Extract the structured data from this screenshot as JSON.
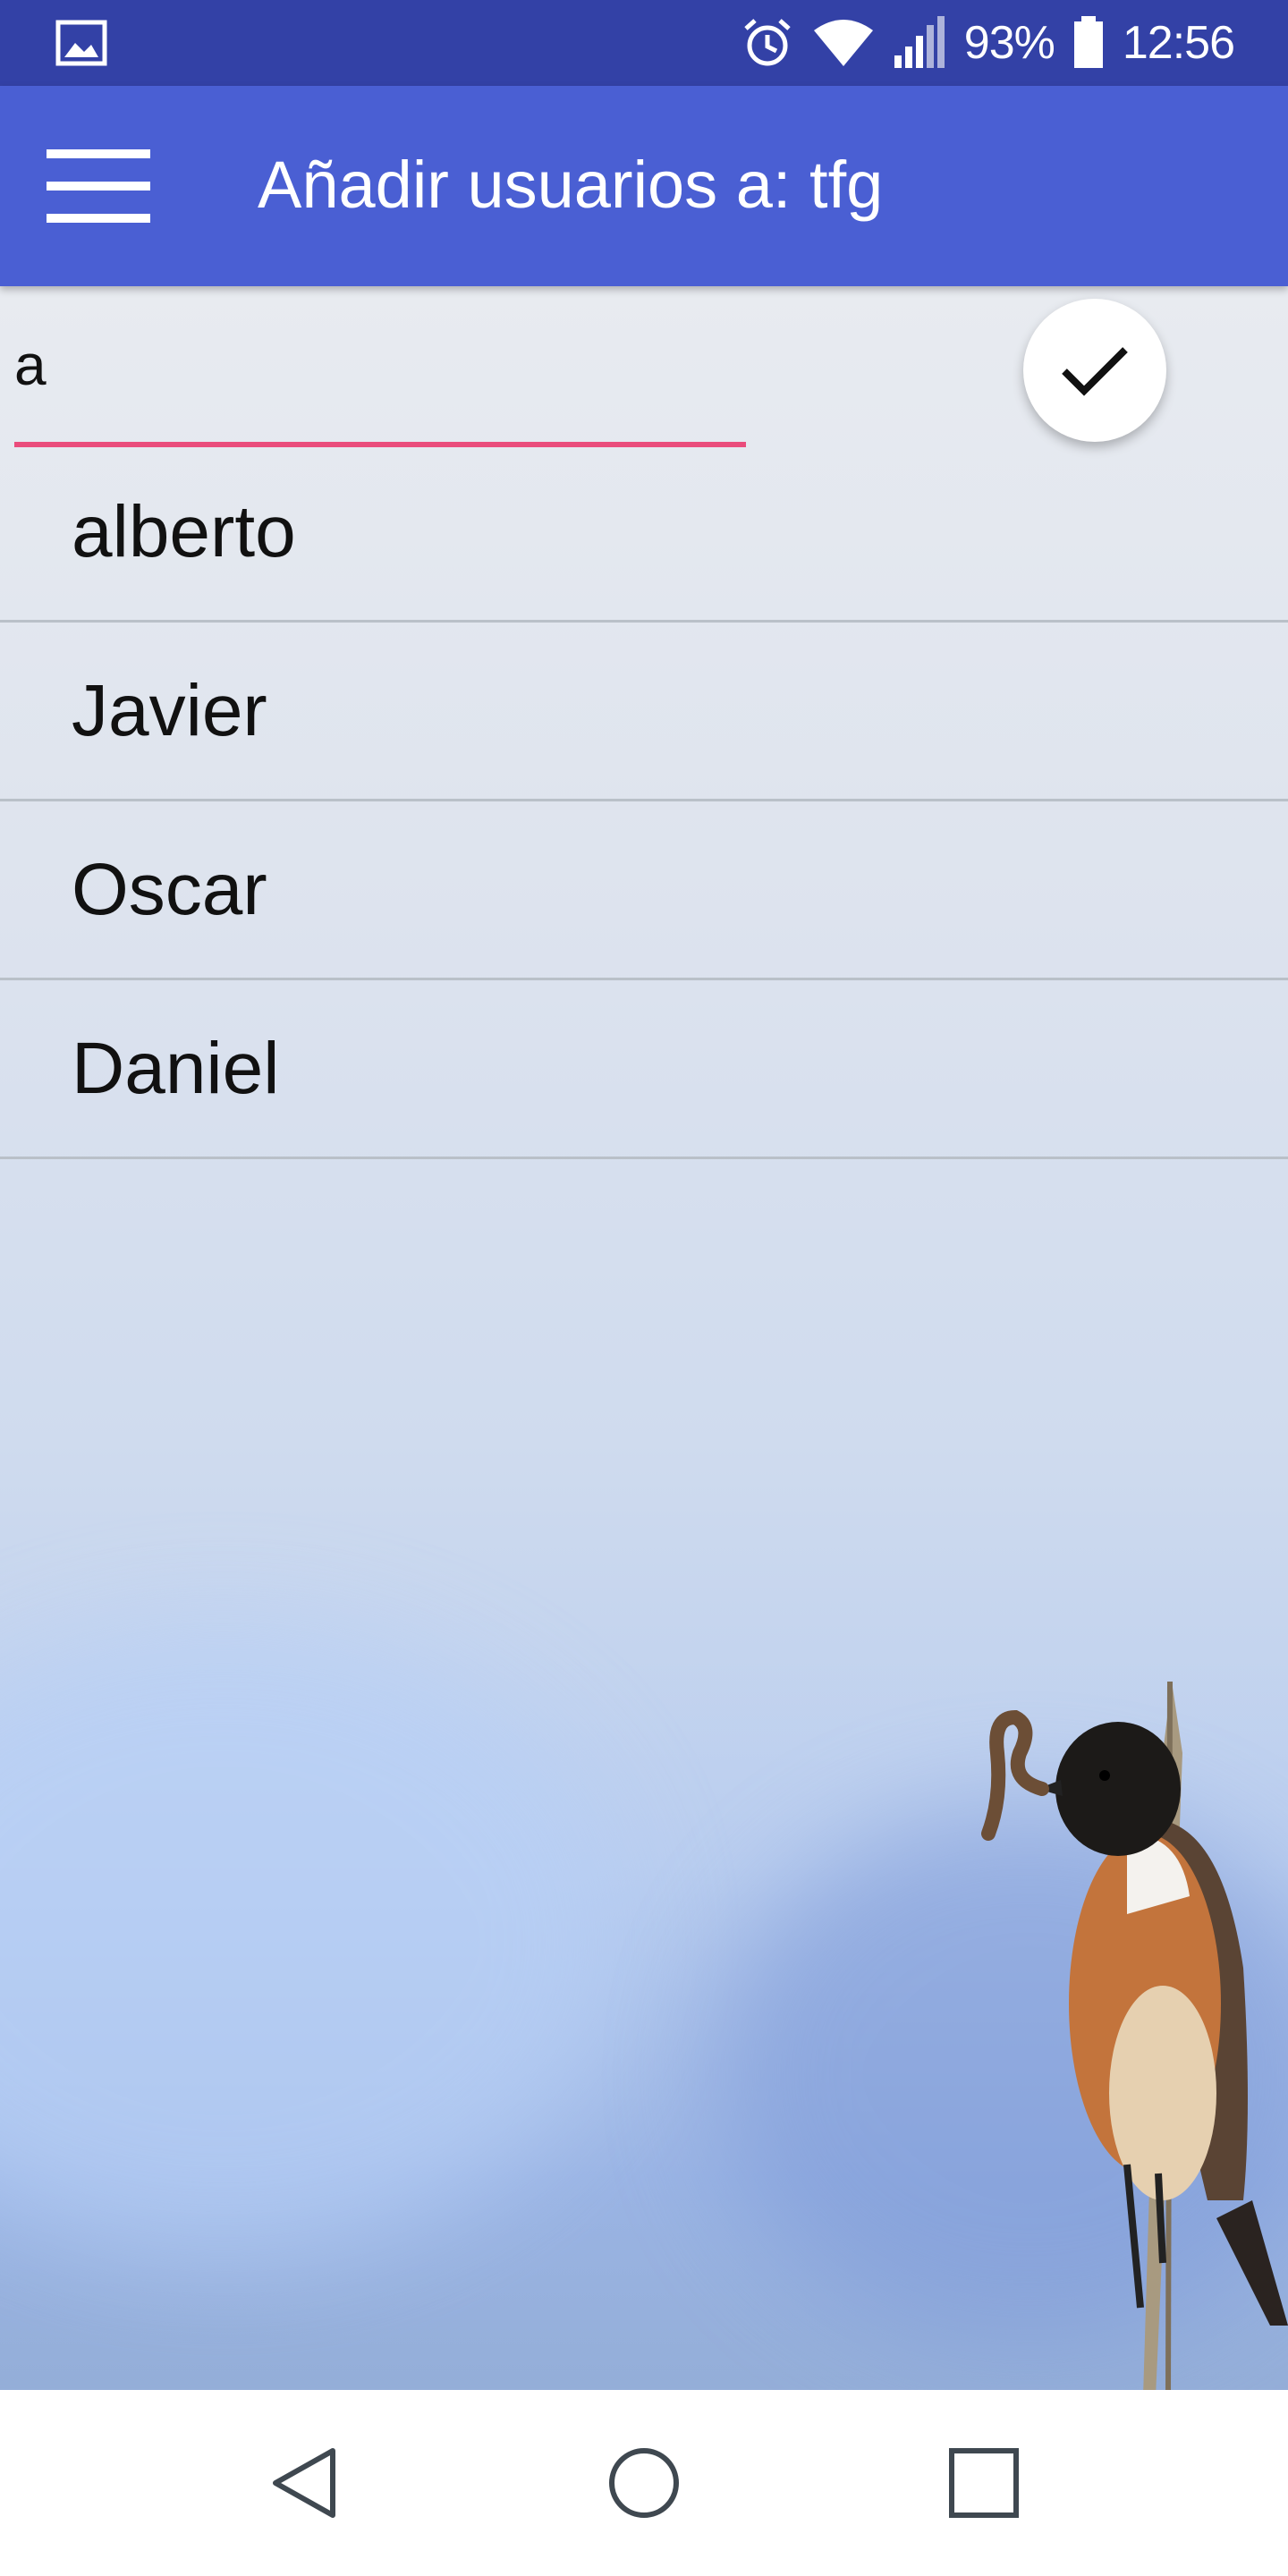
{
  "status_bar": {
    "battery": "93%",
    "time": "12:56",
    "icons": [
      "gallery-icon",
      "alarm-icon",
      "wifi-icon",
      "signal-icon",
      "battery-icon"
    ]
  },
  "app_bar": {
    "title": "Añadir usuarios a: tfg",
    "menu_icon": "hamburger-menu-icon"
  },
  "search": {
    "value": "a",
    "placeholder": ""
  },
  "confirm_button": {
    "icon": "check-icon"
  },
  "users": [
    "alberto",
    "Javier",
    "Oscar",
    "Daniel"
  ],
  "nav_bar": {
    "icons": [
      "back-icon",
      "home-icon",
      "recents-icon"
    ]
  },
  "colors": {
    "status_bar": "#3341a6",
    "app_bar": "#4a5fd3",
    "accent": "#ea4c7c"
  }
}
